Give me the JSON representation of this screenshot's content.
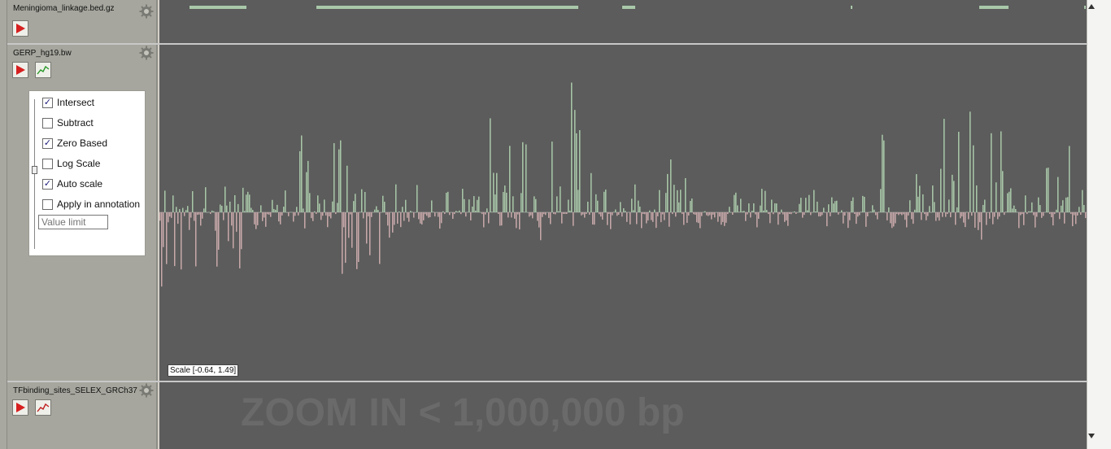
{
  "tracks": [
    {
      "name": "Meningioma_linkage.bed.gz"
    },
    {
      "name": "GERP_hg19.bw"
    },
    {
      "name": "TFbinding_sites_SELEX_GRCh37"
    }
  ],
  "options_panel": {
    "options": [
      {
        "label": "Intersect",
        "checked": true
      },
      {
        "label": "Subtract",
        "checked": false
      },
      {
        "label": "Zero Based",
        "checked": true
      },
      {
        "label": "Log Scale",
        "checked": false
      },
      {
        "label": "Auto scale",
        "checked": true
      },
      {
        "label": "Apply in annotation",
        "checked": false
      }
    ],
    "value_limit_placeholder": "Value limit"
  },
  "scale_label": "Scale [-0.64, 1.49]",
  "zoom_message": "ZOOM IN < 1,000,000 bp",
  "colors": {
    "positive_bar": "#a9c8a9",
    "negative_bar": "#c9a9aa",
    "feature_bar": "#a9c8a9",
    "canvas_bg": "#5c5c5c",
    "play_red": "#d62020"
  },
  "icons": {
    "play": "play-icon",
    "gear": "gear-icon",
    "graph_green": "line-graph-icon-green",
    "graph_red": "line-graph-icon-red"
  }
}
